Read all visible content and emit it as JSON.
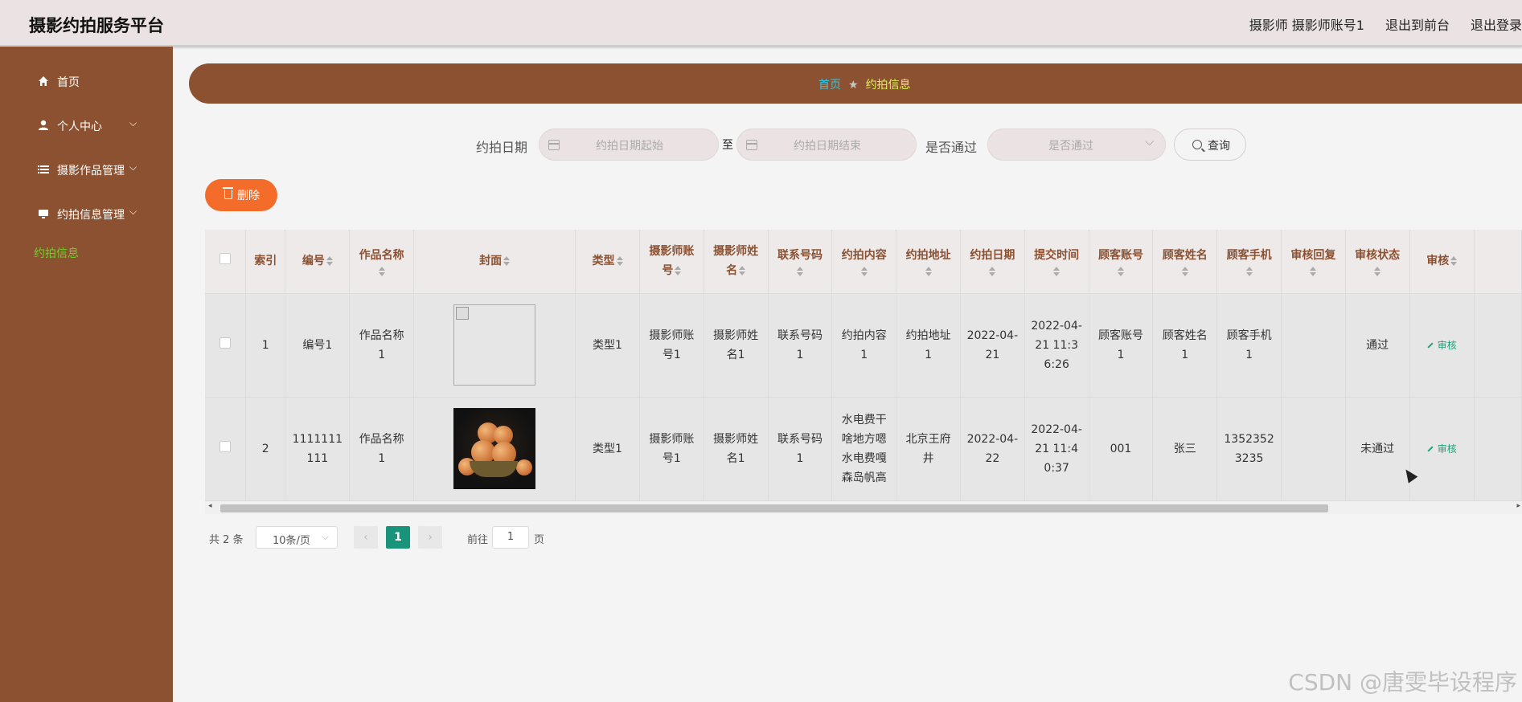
{
  "header": {
    "title": "摄影约拍服务平台",
    "user": "摄影师 摄影师账号1",
    "to_front": "退出到前台",
    "logout": "退出登录"
  },
  "sidebar": {
    "items": [
      {
        "label": "首页",
        "icon": "home-icon"
      },
      {
        "label": "个人中心",
        "icon": "user-icon"
      },
      {
        "label": "摄影作品管理",
        "icon": "list-icon"
      },
      {
        "label": "约拍信息管理",
        "icon": "monitor-icon"
      }
    ],
    "active_sub": "约拍信息"
  },
  "breadcrumb": {
    "home": "首页",
    "sep": "★",
    "current": "约拍信息"
  },
  "search": {
    "date_label": "约拍日期",
    "date_start_placeholder": "约拍日期起始",
    "to": "至",
    "date_end_placeholder": "约拍日期结束",
    "pass_label": "是否通过",
    "pass_placeholder": "是否通过",
    "query": "查询"
  },
  "actions": {
    "delete": "删除"
  },
  "table": {
    "columns": [
      "索引",
      "编号",
      "作品名称",
      "封面",
      "类型",
      "摄影师账号",
      "摄影师姓名",
      "联系号码",
      "约拍内容",
      "约拍地址",
      "约拍日期",
      "提交时间",
      "顾客账号",
      "顾客姓名",
      "顾客手机",
      "审核回复",
      "审核状态",
      "审核"
    ],
    "rows": [
      {
        "index": "1",
        "no": "编号1",
        "work": "作品名称1",
        "type": "类型1",
        "p_account": "摄影师账号1",
        "p_name": "摄影师姓名1",
        "phone": "联系号码1",
        "content": "约拍内容1",
        "address": "约拍地址1",
        "date": "2022-04-21",
        "submit": "2022-04-21 11:36:26",
        "c_account": "顾客账号1",
        "c_name": "顾客姓名1",
        "c_phone": "顾客手机1",
        "reply": "",
        "status": "通过",
        "audit": "审核"
      },
      {
        "index": "2",
        "no": "1111111111",
        "work": "作品名称1",
        "type": "类型1",
        "p_account": "摄影师账号1",
        "p_name": "摄影师姓名1",
        "phone": "联系号码1",
        "content": "水电费干啥地方嗯水电费嘎森岛帆高",
        "address": "北京王府井",
        "date": "2022-04-22",
        "submit": "2022-04-21 11:40:37",
        "c_account": "001",
        "c_name": "张三",
        "c_phone": "13523523235",
        "reply": "",
        "status": "未通过",
        "audit": "审核"
      }
    ]
  },
  "pager": {
    "total": "共 2 条",
    "page_size": "10条/页",
    "current": "1",
    "goto_label": "前往",
    "goto_value": "1",
    "goto_suffix": "页"
  },
  "watermark": "CSDN @唐雯毕设程序"
}
